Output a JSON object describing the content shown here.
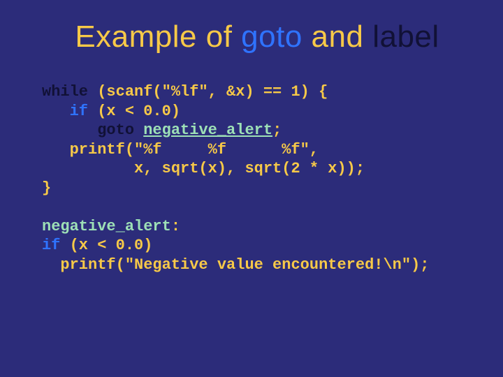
{
  "title": {
    "w1": "Example",
    "w2": "of",
    "w3": "goto",
    "w4": "and",
    "w5": "label"
  },
  "code": {
    "l1a": "while",
    "l1b": " (scanf(\"%lf\", &x) == 1) {",
    "l2a": "   ",
    "l2b": "if",
    "l2c": " (x < 0.0)",
    "l3a": "      ",
    "l3b": "goto",
    "l3c": " ",
    "l3d": "negative_alert",
    "l3e": ";",
    "l4": "   printf(\"%f     %f      %f\",",
    "l5": "          x, sqrt(x), sqrt(2 * x));",
    "l6": "}",
    "blank": "",
    "l8a": "negative_alert",
    "l8b": ":",
    "l9a": "if",
    "l9b": " (x < 0.0)",
    "l10": "  printf(\"Negative value encountered!\\n\");"
  }
}
